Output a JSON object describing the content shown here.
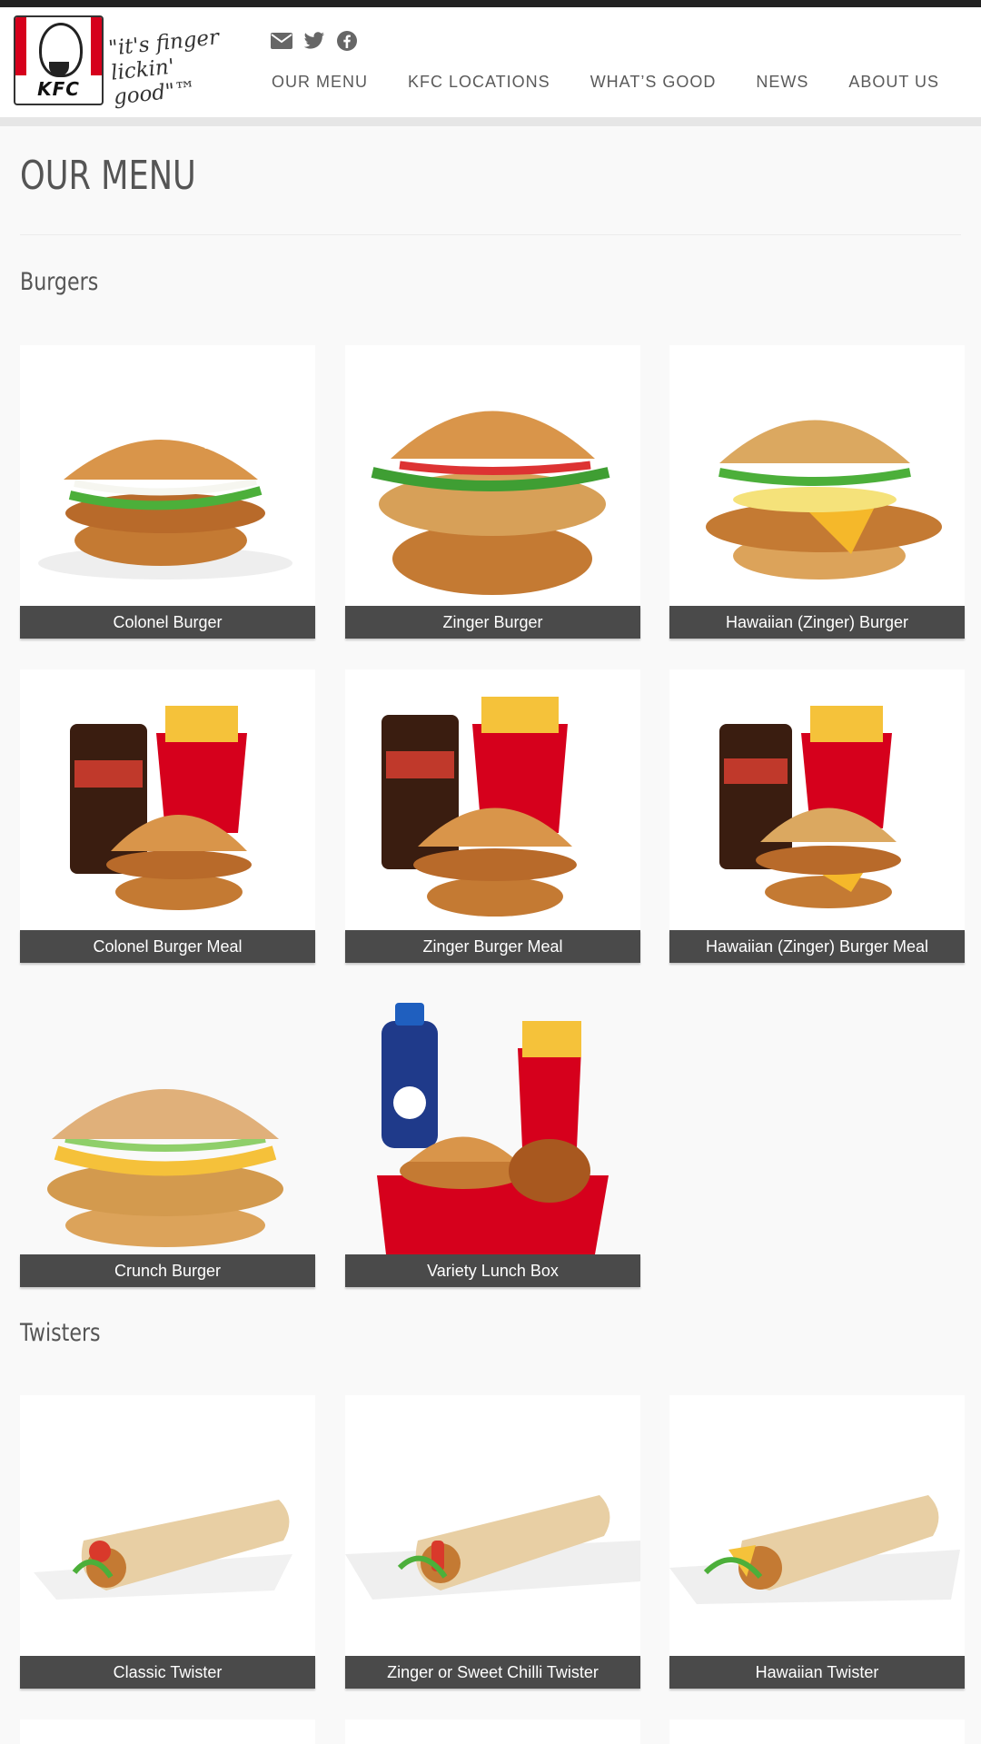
{
  "header": {
    "logo_text": "KFC",
    "tagline": "\"it's finger lickin' good\"™",
    "social": [
      {
        "icon": "envelope-icon",
        "label": "Email"
      },
      {
        "icon": "twitter-icon",
        "label": "Twitter"
      },
      {
        "icon": "facebook-icon",
        "label": "Facebook"
      }
    ],
    "nav": [
      "OUR MENU",
      "KFC LOCATIONS",
      "WHAT’S GOOD",
      "NEWS",
      "ABOUT US"
    ]
  },
  "page": {
    "title": "OUR MENU"
  },
  "sections": [
    {
      "title": "Burgers",
      "items": [
        {
          "name": "Colonel Burger",
          "image": "burger"
        },
        {
          "name": "Zinger Burger",
          "image": "burger"
        },
        {
          "name": "Hawaiian (Zinger) Burger",
          "image": "burger-cheese"
        },
        {
          "name": "Colonel Burger Meal",
          "image": "meal"
        },
        {
          "name": "Zinger Burger Meal",
          "image": "meal"
        },
        {
          "name": "Hawaiian (Zinger) Burger Meal",
          "image": "meal"
        },
        {
          "name": "Crunch Burger",
          "image": "burger-cheese"
        },
        {
          "name": "Variety Lunch Box",
          "image": "lunch-box"
        }
      ]
    },
    {
      "title": "Twisters",
      "items": [
        {
          "name": "Classic Twister",
          "image": "wrap"
        },
        {
          "name": "Zinger or Sweet Chilli Twister",
          "image": "wrap"
        },
        {
          "name": "Hawaiian Twister",
          "image": "wrap"
        }
      ]
    }
  ],
  "colors": {
    "brand_red": "#d6001c",
    "caption_bg": "#4a4a4a",
    "text": "#5a5a5a"
  }
}
